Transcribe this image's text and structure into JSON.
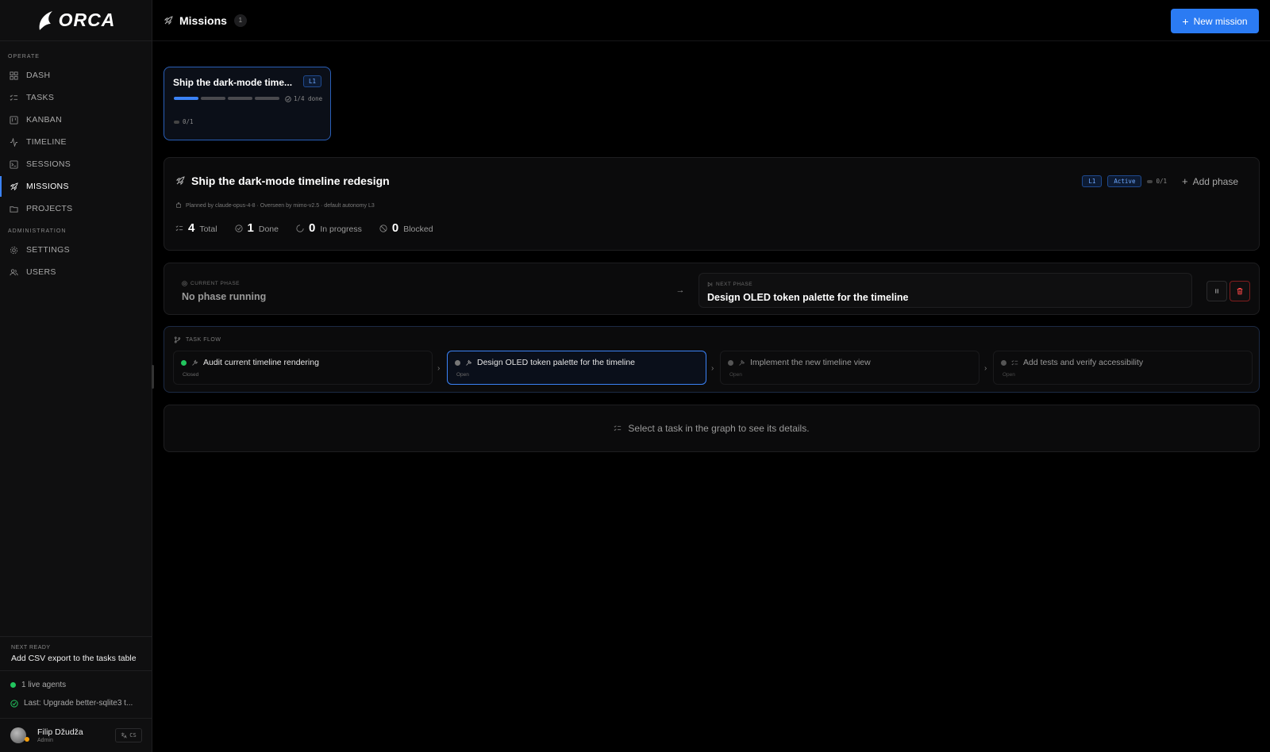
{
  "app": {
    "name": "ORCA"
  },
  "sidebar": {
    "section_operate": "OPERATE",
    "section_admin": "ADMINISTRATION",
    "items": [
      {
        "label": "DASH",
        "icon": "grid-icon"
      },
      {
        "label": "TASKS",
        "icon": "list-check-icon"
      },
      {
        "label": "KANBAN",
        "icon": "kanban-icon"
      },
      {
        "label": "TIMELINE",
        "icon": "activity-icon"
      },
      {
        "label": "SESSIONS",
        "icon": "terminal-icon"
      },
      {
        "label": "MISSIONS",
        "icon": "rocket-icon",
        "active": true
      },
      {
        "label": "PROJECTS",
        "icon": "folder-icon"
      }
    ],
    "admin_items": [
      {
        "label": "SETTINGS",
        "icon": "gear-icon"
      },
      {
        "label": "USERS",
        "icon": "users-icon"
      }
    ],
    "next_ready": {
      "label": "NEXT READY",
      "value": "Add CSV export to the tasks table"
    },
    "live_agents": "1 live agents",
    "last": "Last: Upgrade better-sqlite3 t...",
    "user": {
      "name": "Filip Džudža",
      "role": "Admin"
    },
    "lang": "CS"
  },
  "header": {
    "title": "Missions",
    "count": "1",
    "new_mission": "New mission"
  },
  "mission_card": {
    "title": "Ship the dark-mode time...",
    "level": "L1",
    "progress_done": 1,
    "progress_total": 4,
    "done_label": "1/4 done",
    "ratio": "0/1"
  },
  "mission_detail": {
    "title": "Ship the dark-mode timeline redesign",
    "meta": "Planned by claude-opus-4-8 · Overseen by mimo-v2.5 · default autonomy L3",
    "level": "L1",
    "status": "Active",
    "ratio": "0/1",
    "add_phase": "Add phase",
    "stats": {
      "total": {
        "num": "4",
        "label": "Total"
      },
      "done": {
        "num": "1",
        "label": "Done"
      },
      "in_progress": {
        "num": "0",
        "label": "In progress"
      },
      "blocked": {
        "num": "0",
        "label": "Blocked"
      }
    }
  },
  "phases": {
    "current_label": "CURRENT PHASE",
    "current_value": "No phase running",
    "next_label": "NEXT PHASE",
    "next_value": "Design OLED token palette for the timeline"
  },
  "task_flow": {
    "label": "TASK FLOW",
    "tasks": [
      {
        "title": "Audit current timeline rendering",
        "status": "Closed"
      },
      {
        "title": "Design OLED token palette for the timeline",
        "status": "Open"
      },
      {
        "title": "Implement the new timeline view",
        "status": "Open"
      },
      {
        "title": "Add tests and verify accessibility",
        "status": "Open"
      }
    ]
  },
  "empty_state": "Select a task in the graph to see its details.",
  "colors": {
    "accent": "#2b7bf3",
    "success": "#22c55e",
    "danger": "#ef4444",
    "warning": "#f59e0b"
  }
}
